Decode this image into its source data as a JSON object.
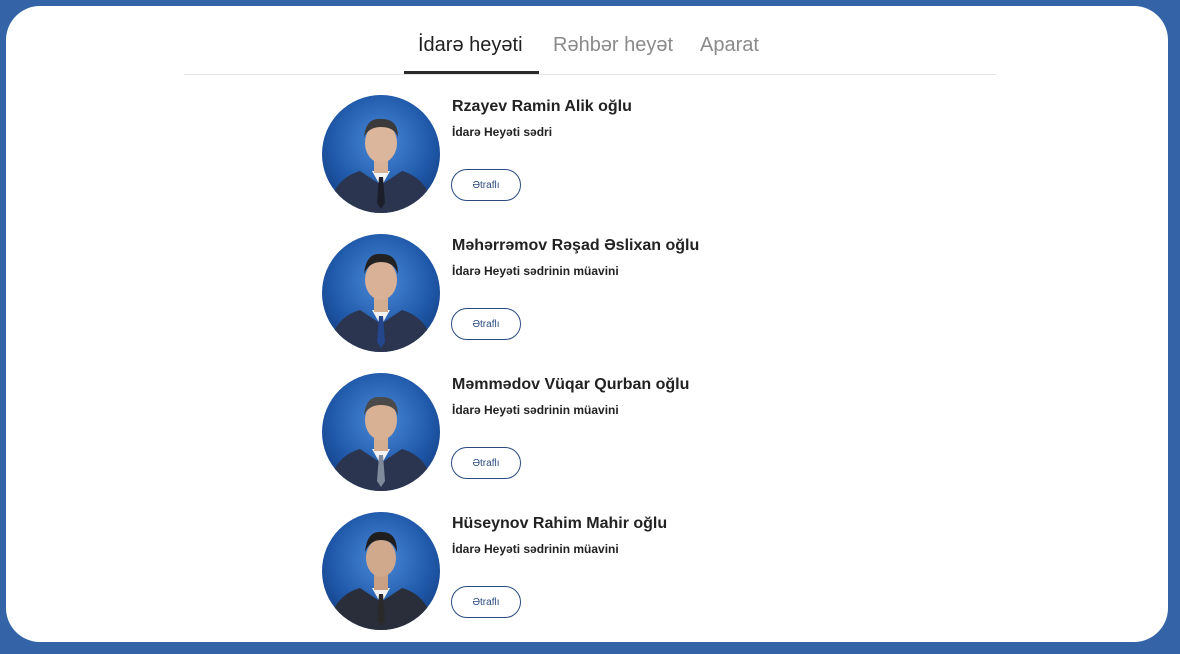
{
  "tabs": [
    {
      "label": "İdarə heyəti",
      "active": true
    },
    {
      "label": "Rəhbər heyət",
      "active": false
    },
    {
      "label": "Aparat",
      "active": false
    }
  ],
  "people": [
    {
      "name": "Rzayev Ramin Alik oğlu",
      "role": "İdarə Heyəti sədri",
      "button": "Ətraflı"
    },
    {
      "name": "Məhərrəmov Rəşad Əslixan oğlu",
      "role": "İdarə Heyəti sədrinin müavini",
      "button": "Ətraflı"
    },
    {
      "name": "Məmmədov Vüqar Qurban oğlu",
      "role": "İdarə Heyəti sədrinin müavini",
      "button": "Ətraflı"
    },
    {
      "name": "Hüseynov Rahim Mahir oğlu",
      "role": "İdarə Heyəti sədrinin müavini",
      "button": "Ətraflı"
    }
  ],
  "colors": {
    "frame_border": "#3563a8",
    "avatar_bg": "#1f58a8",
    "button_border": "#2a4a7f"
  },
  "icons": {
    "avatar": "person-portrait-icon"
  }
}
